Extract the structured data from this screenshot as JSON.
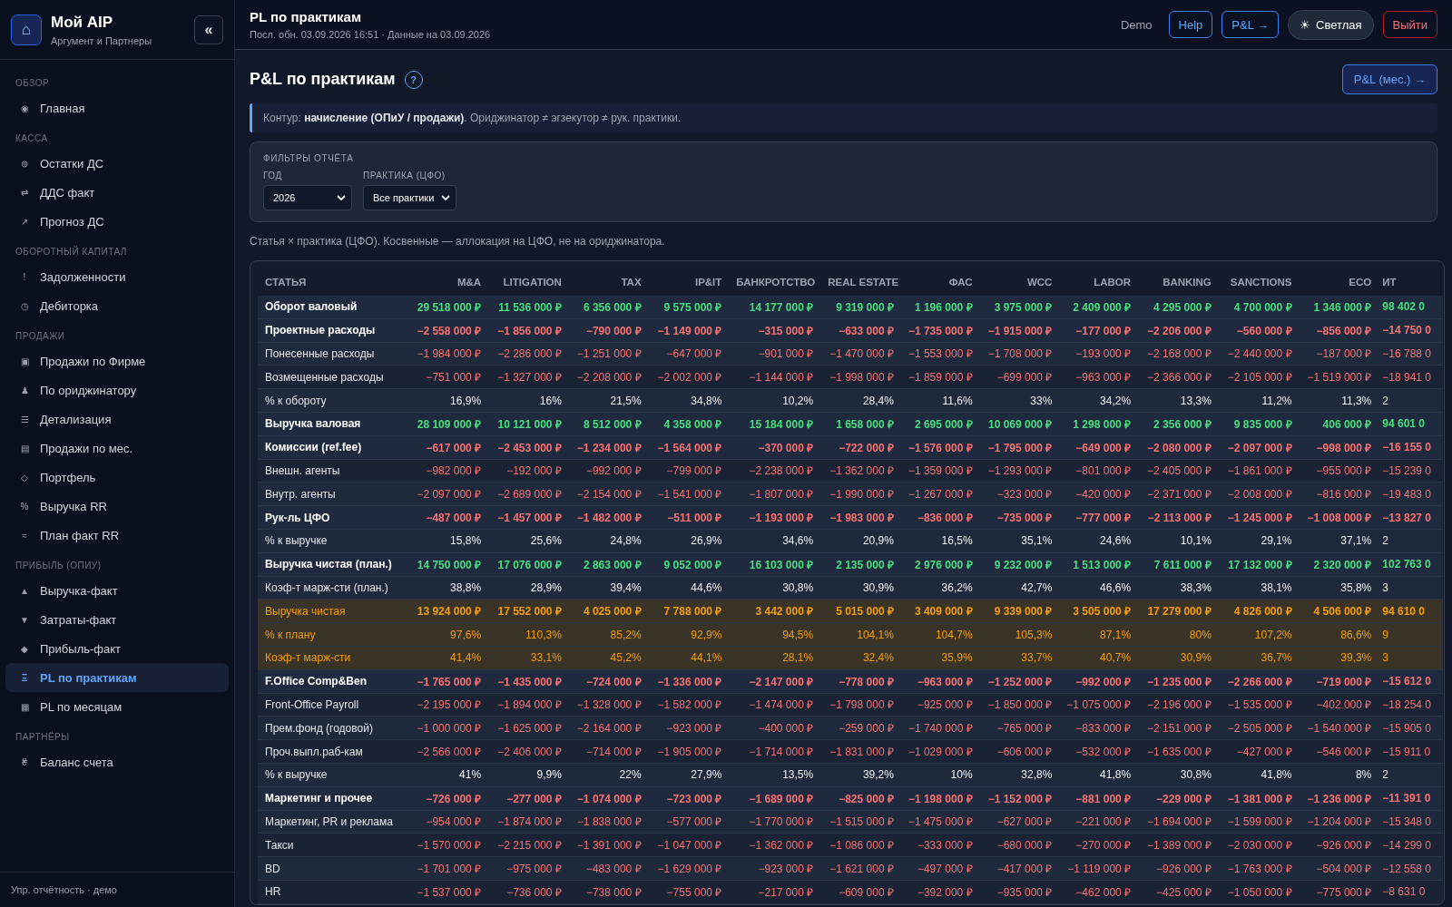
{
  "sidebar": {
    "logo_icon": "⌂",
    "brand": "Мой AIP",
    "subtitle": "Аргумент и Партнеры",
    "collapse": "«",
    "sections": [
      {
        "title": "ОБЗОР",
        "items": [
          {
            "icon": "◉",
            "label": "Главная",
            "selected": false
          }
        ]
      },
      {
        "title": "КАССА",
        "items": [
          {
            "icon": "⊚",
            "label": "Остатки ДС",
            "selected": false
          },
          {
            "icon": "⇄",
            "label": "ДДС факт",
            "selected": false
          },
          {
            "icon": "↗",
            "label": "Прогноз ДС",
            "selected": false
          }
        ]
      },
      {
        "title": "ОБОРОТНЫЙ КАПИТАЛ",
        "items": [
          {
            "icon": "!",
            "label": "Задолженности",
            "selected": false
          },
          {
            "icon": "◷",
            "label": "Дебиторка",
            "selected": false
          }
        ]
      },
      {
        "title": "ПРОДАЖИ",
        "items": [
          {
            "icon": "▣",
            "label": "Продажи по Фирме",
            "selected": false
          },
          {
            "icon": "♟",
            "label": "По ориджинатору",
            "selected": false
          },
          {
            "icon": "☰",
            "label": "Детализация",
            "selected": false
          },
          {
            "icon": "▤",
            "label": "Продажи по мес.",
            "selected": false
          },
          {
            "icon": "◇",
            "label": "Портфель",
            "selected": false
          },
          {
            "icon": "%",
            "label": "Выручка RR",
            "selected": false
          },
          {
            "icon": "≈",
            "label": "План факт RR",
            "selected": false
          }
        ]
      },
      {
        "title": "ПРИБЫЛЬ (ОПИУ)",
        "items": [
          {
            "icon": "▲",
            "label": "Выручка-факт",
            "selected": false
          },
          {
            "icon": "▼",
            "label": "Затраты-факт",
            "selected": false
          },
          {
            "icon": "◆",
            "label": "Прибыль-факт",
            "selected": false
          },
          {
            "icon": "Ξ",
            "label": "PL по практикам",
            "selected": true
          },
          {
            "icon": "▦",
            "label": "PL по месяцам",
            "selected": false
          }
        ]
      },
      {
        "title": "ПАРТНЁРЫ",
        "items": [
          {
            "icon": "₴",
            "label": "Баланс счета",
            "selected": false
          }
        ]
      }
    ],
    "footer": "Упр. отчётность · демо"
  },
  "topbar": {
    "title": "PL по практикам",
    "subtitle": "Посл. обн. 03.09.2026 16:51 · Данные на 03.09.2026",
    "actions": [
      {
        "kind": "text",
        "label": "Demo"
      },
      {
        "kind": "outline",
        "label": "Help"
      },
      {
        "kind": "outline",
        "label": "P&L →"
      },
      {
        "kind": "theme",
        "icon": "☀",
        "label": "Светлая"
      },
      {
        "kind": "danger",
        "label": "Выйти"
      }
    ]
  },
  "page": {
    "title": "P&L по практикам",
    "help": "?",
    "action": "P&L (мес.) →",
    "notice": "Контур: **начисление (ОПиУ / продажи)**. Ориджинатор ≠ эгзекутор ≠ рук. практики.",
    "filters": {
      "title": "ФИЛЬТРЫ ОТЧЁТА",
      "fields": [
        {
          "label": "ГОД",
          "value": "2026"
        },
        {
          "label": "ПРАКТИКА (ЦФО)",
          "value": "Все практики"
        }
      ]
    },
    "caption": "Статья × практика (ЦФО). Косвенные — аллокация на ЦФО, не на ориджинатора."
  },
  "table": {
    "columns": [
      "СТАТЬЯ",
      "M&A",
      "LITIGATION",
      "TAX",
      "IP&IT",
      "БАНКРОТСТВО",
      "REAL ESTATE",
      "ФАС",
      "WCC",
      "LABOR",
      "BANKING",
      "SANCTIONS",
      "ECO",
      "ИТ"
    ],
    "rows": [
      {
        "kind": "income",
        "label": "Оборот валовый",
        "values": [
          "29 518 000 ₽",
          "11 536 000 ₽",
          "6 356 000 ₽",
          "9 575 000 ₽",
          "14 177 000 ₽",
          "9 319 000 ₽",
          "1 196 000 ₽",
          "3 975 000 ₽",
          "2 409 000 ₽",
          "4 295 000 ₽",
          "4 700 000 ₽",
          "1 346 000 ₽",
          "98 402 0"
        ]
      },
      {
        "kind": "subtotal",
        "label": "Проектные расходы",
        "values": [
          "−2 558 000 ₽",
          "−1 856 000 ₽",
          "−790 000 ₽",
          "−1 149 000 ₽",
          "−315 000 ₽",
          "−633 000 ₽",
          "−1 735 000 ₽",
          "−1 915 000 ₽",
          "−177 000 ₽",
          "−2 206 000 ₽",
          "−560 000 ₽",
          "−856 000 ₽",
          "−14 750 0"
        ]
      },
      {
        "kind": "cost",
        "label": "Понесенные расходы",
        "values": [
          "−1 984 000 ₽",
          "−2 286 000 ₽",
          "−1 251 000 ₽",
          "−647 000 ₽",
          "−901 000 ₽",
          "−1 470 000 ₽",
          "−1 553 000 ₽",
          "−1 708 000 ₽",
          "−193 000 ₽",
          "−2 168 000 ₽",
          "−2 440 000 ₽",
          "−187 000 ₽",
          "−16 788 0"
        ]
      },
      {
        "kind": "cost",
        "label": "Возмещенные расходы",
        "values": [
          "−751 000 ₽",
          "−1 327 000 ₽",
          "−2 208 000 ₽",
          "−2 002 000 ₽",
          "−1 144 000 ₽",
          "−1 998 000 ₽",
          "−1 859 000 ₽",
          "−699 000 ₽",
          "−963 000 ₽",
          "−2 366 000 ₽",
          "−2 105 000 ₽",
          "−1 519 000 ₽",
          "−18 941 0"
        ]
      },
      {
        "kind": "ratio",
        "label": "% к обороту",
        "values": [
          "16,9%",
          "16%",
          "21,5%",
          "34,8%",
          "10,2%",
          "28,4%",
          "11,6%",
          "33%",
          "34,2%",
          "13,3%",
          "11,2%",
          "11,3%",
          "2"
        ]
      },
      {
        "kind": "income",
        "label": "Выручка валовая",
        "values": [
          "28 109 000 ₽",
          "10 121 000 ₽",
          "8 512 000 ₽",
          "4 358 000 ₽",
          "15 184 000 ₽",
          "1 658 000 ₽",
          "2 695 000 ₽",
          "10 069 000 ₽",
          "1 298 000 ₽",
          "2 356 000 ₽",
          "9 835 000 ₽",
          "406 000 ₽",
          "94 601 0"
        ]
      },
      {
        "kind": "subtotal",
        "label": "Комиссии (ref.fee)",
        "values": [
          "−617 000 ₽",
          "−2 453 000 ₽",
          "−1 234 000 ₽",
          "−1 564 000 ₽",
          "−370 000 ₽",
          "−722 000 ₽",
          "−1 576 000 ₽",
          "−1 795 000 ₽",
          "−649 000 ₽",
          "−2 080 000 ₽",
          "−2 097 000 ₽",
          "−998 000 ₽",
          "−16 155 0"
        ]
      },
      {
        "kind": "cost",
        "label": "Внешн. агенты",
        "values": [
          "−982 000 ₽",
          "−192 000 ₽",
          "−992 000 ₽",
          "−799 000 ₽",
          "−2 238 000 ₽",
          "−1 362 000 ₽",
          "−1 359 000 ₽",
          "−1 293 000 ₽",
          "−801 000 ₽",
          "−2 405 000 ₽",
          "−1 861 000 ₽",
          "−955 000 ₽",
          "−15 239 0"
        ]
      },
      {
        "kind": "cost",
        "label": "Внутр. агенты",
        "values": [
          "−2 097 000 ₽",
          "−2 689 000 ₽",
          "−2 154 000 ₽",
          "−1 541 000 ₽",
          "−1 807 000 ₽",
          "−1 990 000 ₽",
          "−1 267 000 ₽",
          "−323 000 ₽",
          "−420 000 ₽",
          "−2 371 000 ₽",
          "−2 008 000 ₽",
          "−816 000 ₽",
          "−19 483 0"
        ]
      },
      {
        "kind": "subtotal",
        "label": "Рук-ль ЦФО",
        "values": [
          "−487 000 ₽",
          "−1 457 000 ₽",
          "−1 482 000 ₽",
          "−511 000 ₽",
          "−1 193 000 ₽",
          "−1 983 000 ₽",
          "−836 000 ₽",
          "−735 000 ₽",
          "−777 000 ₽",
          "−2 113 000 ₽",
          "−1 245 000 ₽",
          "−1 008 000 ₽",
          "−13 827 0"
        ]
      },
      {
        "kind": "ratio",
        "label": "% к выручке",
        "values": [
          "15,8%",
          "25,6%",
          "24,8%",
          "26,9%",
          "34,6%",
          "20,9%",
          "16,5%",
          "35,1%",
          "24,6%",
          "10,1%",
          "29,1%",
          "37,1%",
          "2"
        ]
      },
      {
        "kind": "income",
        "label": "Выручка чистая (план.)",
        "values": [
          "14 750 000 ₽",
          "17 076 000 ₽",
          "2 863 000 ₽",
          "9 052 000 ₽",
          "16 103 000 ₽",
          "2 135 000 ₽",
          "2 976 000 ₽",
          "9 232 000 ₽",
          "1 513 000 ₽",
          "7 611 000 ₽",
          "17 132 000 ₽",
          "2 320 000 ₽",
          "102 763 0"
        ]
      },
      {
        "kind": "ratio",
        "label": "Коэф-т марж-сти (план.)",
        "values": [
          "38,8%",
          "28,9%",
          "39,4%",
          "44,6%",
          "30,8%",
          "30,9%",
          "36,2%",
          "42,7%",
          "46,6%",
          "38,3%",
          "38,1%",
          "35,8%",
          "3"
        ]
      },
      {
        "kind": "result",
        "label": "Выручка чистая",
        "values": [
          "13 924 000 ₽",
          "17 552 000 ₽",
          "4 025 000 ₽",
          "7 788 000 ₽",
          "3 442 000 ₽",
          "5 015 000 ₽",
          "3 409 000 ₽",
          "9 339 000 ₽",
          "3 505 000 ₽",
          "17 279 000 ₽",
          "4 826 000 ₽",
          "4 506 000 ₽",
          "94 610 0"
        ]
      },
      {
        "kind": "plan",
        "label": "% к плану",
        "values": [
          "97,6%",
          "110,3%",
          "85,2%",
          "92,9%",
          "94,5%",
          "104,1%",
          "104,7%",
          "105,3%",
          "87,1%",
          "80%",
          "107,2%",
          "86,6%",
          "9"
        ]
      },
      {
        "kind": "plan",
        "label": "Коэф-т марж-сти",
        "values": [
          "41,4%",
          "33,1%",
          "45,2%",
          "44,1%",
          "28,1%",
          "32,4%",
          "35,9%",
          "33,7%",
          "40,7%",
          "30,9%",
          "36,7%",
          "39,3%",
          "3"
        ]
      },
      {
        "kind": "subtotal",
        "label": "F.Office Comp&Ben",
        "values": [
          "−1 765 000 ₽",
          "−1 435 000 ₽",
          "−724 000 ₽",
          "−1 336 000 ₽",
          "−2 147 000 ₽",
          "−778 000 ₽",
          "−963 000 ₽",
          "−1 252 000 ₽",
          "−992 000 ₽",
          "−1 235 000 ₽",
          "−2 266 000 ₽",
          "−719 000 ₽",
          "−15 612 0"
        ]
      },
      {
        "kind": "cost",
        "label": "Front-Office Payroll",
        "values": [
          "−2 195 000 ₽",
          "−1 894 000 ₽",
          "−1 328 000 ₽",
          "−1 582 000 ₽",
          "−1 474 000 ₽",
          "−1 798 000 ₽",
          "−925 000 ₽",
          "−1 850 000 ₽",
          "−1 075 000 ₽",
          "−2 196 000 ₽",
          "−1 535 000 ₽",
          "−402 000 ₽",
          "−18 254 0"
        ]
      },
      {
        "kind": "cost",
        "label": "Прем.фонд (годовой)",
        "values": [
          "−1 000 000 ₽",
          "−1 625 000 ₽",
          "−2 164 000 ₽",
          "−923 000 ₽",
          "−400 000 ₽",
          "−259 000 ₽",
          "−1 740 000 ₽",
          "−765 000 ₽",
          "−833 000 ₽",
          "−2 151 000 ₽",
          "−2 505 000 ₽",
          "−1 540 000 ₽",
          "−15 905 0"
        ]
      },
      {
        "kind": "cost",
        "label": "Проч.выпл.раб-кам",
        "values": [
          "−2 566 000 ₽",
          "−2 406 000 ₽",
          "−714 000 ₽",
          "−1 905 000 ₽",
          "−1 714 000 ₽",
          "−1 831 000 ₽",
          "−1 029 000 ₽",
          "−606 000 ₽",
          "−532 000 ₽",
          "−1 635 000 ₽",
          "−427 000 ₽",
          "−546 000 ₽",
          "−15 911 0"
        ]
      },
      {
        "kind": "ratio",
        "label": "% к выручке",
        "values": [
          "41%",
          "9,9%",
          "22%",
          "27,9%",
          "13,5%",
          "39,2%",
          "10%",
          "32,8%",
          "41,8%",
          "30,8%",
          "41,8%",
          "8%",
          "2"
        ]
      },
      {
        "kind": "subtotal",
        "label": "Маркетинг и прочее",
        "values": [
          "−726 000 ₽",
          "−277 000 ₽",
          "−1 074 000 ₽",
          "−723 000 ₽",
          "−1 689 000 ₽",
          "−825 000 ₽",
          "−1 198 000 ₽",
          "−1 152 000 ₽",
          "−881 000 ₽",
          "−229 000 ₽",
          "−1 381 000 ₽",
          "−1 236 000 ₽",
          "−11 391 0"
        ]
      },
      {
        "kind": "cost",
        "label": "Маркетинг, PR и реклама",
        "values": [
          "−954 000 ₽",
          "−1 874 000 ₽",
          "−1 838 000 ₽",
          "−577 000 ₽",
          "−1 770 000 ₽",
          "−1 515 000 ₽",
          "−1 475 000 ₽",
          "−627 000 ₽",
          "−221 000 ₽",
          "−1 694 000 ₽",
          "−1 599 000 ₽",
          "−1 204 000 ₽",
          "−15 348 0"
        ]
      },
      {
        "kind": "cost",
        "label": "Такси",
        "values": [
          "−1 570 000 ₽",
          "−2 215 000 ₽",
          "−1 391 000 ₽",
          "−1 047 000 ₽",
          "−1 362 000 ₽",
          "−1 086 000 ₽",
          "−333 000 ₽",
          "−680 000 ₽",
          "−270 000 ₽",
          "−1 389 000 ₽",
          "−2 030 000 ₽",
          "−926 000 ₽",
          "−14 299 0"
        ]
      },
      {
        "kind": "cost",
        "label": "BD",
        "values": [
          "−1 701 000 ₽",
          "−975 000 ₽",
          "−483 000 ₽",
          "−1 629 000 ₽",
          "−923 000 ₽",
          "−1 621 000 ₽",
          "−497 000 ₽",
          "−417 000 ₽",
          "−1 119 000 ₽",
          "−926 000 ₽",
          "−1 763 000 ₽",
          "−504 000 ₽",
          "−12 558 0"
        ]
      },
      {
        "kind": "cost",
        "label": "HR",
        "values": [
          "−1 537 000 ₽",
          "−736 000 ₽",
          "−738 000 ₽",
          "−755 000 ₽",
          "−217 000 ₽",
          "−609 000 ₽",
          "−392 000 ₽",
          "−935 000 ₽",
          "−462 000 ₽",
          "−425 000 ₽",
          "−1 050 000 ₽",
          "−775 000 ₽",
          "−8 631 0"
        ]
      }
    ]
  }
}
